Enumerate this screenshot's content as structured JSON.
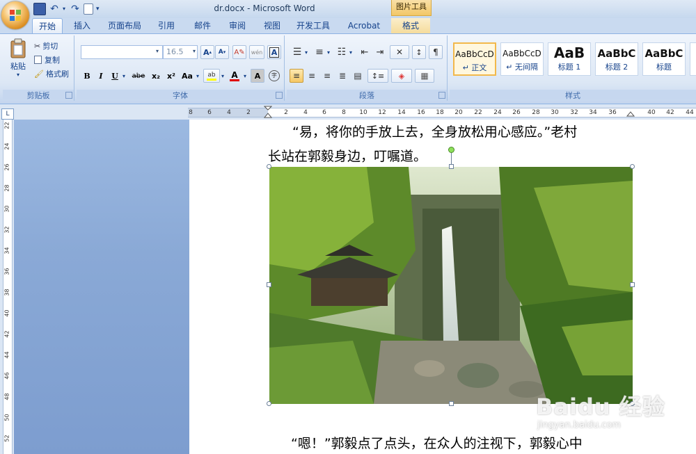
{
  "titlebar": {
    "document_title": "dr.docx - Microsoft Word",
    "contextual_tools": "图片工具"
  },
  "tabs": [
    {
      "label": "开始",
      "active": true
    },
    {
      "label": "插入"
    },
    {
      "label": "页面布局"
    },
    {
      "label": "引用"
    },
    {
      "label": "邮件"
    },
    {
      "label": "审阅"
    },
    {
      "label": "视图"
    },
    {
      "label": "开发工具"
    },
    {
      "label": "Acrobat"
    },
    {
      "label": "格式",
      "contextual": true
    }
  ],
  "clipboard": {
    "paste": "粘贴",
    "cut": "剪切",
    "copy": "复制",
    "format_painter": "格式刷",
    "group_label": "剪贴板"
  },
  "font": {
    "font_name": "",
    "font_size": "16.5",
    "bold": "B",
    "italic": "I",
    "underline": "U",
    "strikethrough": "abe",
    "subscript": "x₂",
    "superscript": "x²",
    "change_case": "Aa",
    "group_label": "字体",
    "highlight_color": "#ffff00",
    "font_color": "#e00000"
  },
  "paragraph": {
    "group_label": "段落"
  },
  "styles": {
    "items": [
      {
        "sample": "AaBbCcD",
        "name": "↵ 正文",
        "selected": true
      },
      {
        "sample": "AaBbCcD",
        "name": "↵ 无间隔"
      },
      {
        "sample": "AaB",
        "name": "标题 1"
      },
      {
        "sample": "AaBbC",
        "name": "标题 2"
      },
      {
        "sample": "AaBbC",
        "name": "标题"
      }
    ],
    "group_label": "样式"
  },
  "ruler": {
    "button": "L",
    "h_ticks": [
      "8",
      "6",
      "4",
      "2",
      "2",
      "4",
      "6",
      "8",
      "10",
      "12",
      "14",
      "16",
      "18",
      "20",
      "22",
      "24",
      "26",
      "28",
      "30",
      "32",
      "34",
      "36",
      "40",
      "42",
      "44"
    ],
    "v_ticks": [
      "22",
      "24",
      "26",
      "28",
      "30",
      "32",
      "34",
      "36",
      "38",
      "40",
      "42",
      "44",
      "46",
      "48",
      "50",
      "52"
    ]
  },
  "document": {
    "para1_line1": "“易，将你的手放上去，全身放松用心感应。”老村",
    "para1_line2": "长站在郭毅身边，叮嘱道。",
    "para2_line1": "“嗯！”郭毅点了点头，在众人的注视下，郭毅心中"
  },
  "watermark": {
    "main": "Baidu 经验",
    "sub": "jingyan.baidu.com"
  }
}
